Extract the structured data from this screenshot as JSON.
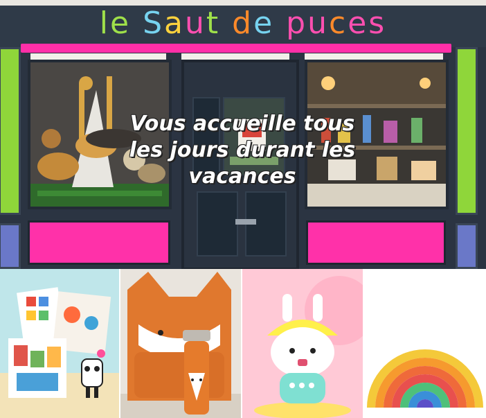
{
  "banner": {
    "shop_name_letters": [
      "l",
      "e",
      " ",
      "S",
      "a",
      "u",
      "t",
      " ",
      "d",
      "e",
      " ",
      "p",
      "u",
      "c",
      "e",
      "s"
    ],
    "shop_name_colors": [
      "#9fe04a",
      "#9fe04a",
      "",
      "#77d3f0",
      "#ffd23d",
      "#ff4fb0",
      "#9fe04a",
      "",
      "#ff8a2a",
      "#77d3f0",
      "",
      "#ff4fb0",
      "#ff4fb0",
      "#ff8a2a",
      "#ff4fb0",
      "#ff4fb0"
    ],
    "overlay_line_1": "Vous accueille tous",
    "overlay_line_2": "les jours durant les",
    "overlay_line_3": "vacances"
  },
  "colors": {
    "facade": "#2b3442",
    "pink": "#ff2fa8",
    "green": "#8fd63a",
    "blue": "#6a78c8"
  },
  "products": [
    {
      "name": "stickers-activity-book-icon"
    },
    {
      "name": "fox-backpack-and-bottle-icon"
    },
    {
      "name": "bunny-night-light-speaker-icon"
    },
    {
      "name": "wooden-rainbow-stacker-icon"
    }
  ]
}
